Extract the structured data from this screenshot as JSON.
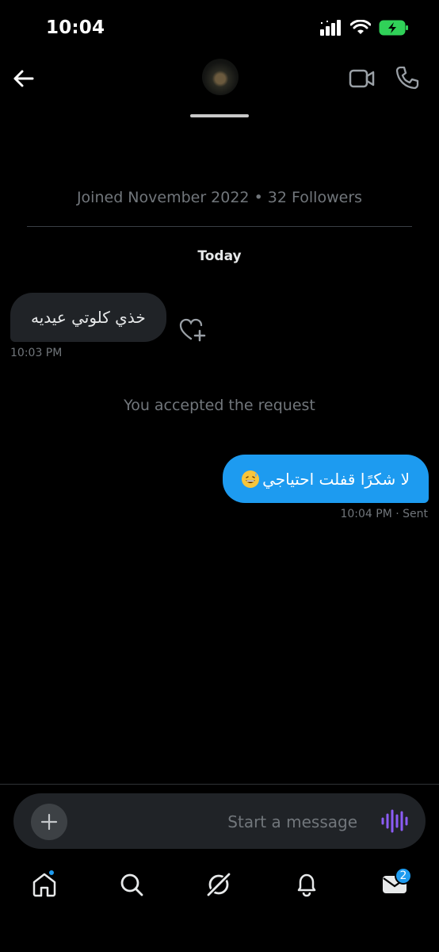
{
  "status_bar": {
    "time": "10:04"
  },
  "header": {
    "avatar_alt": "",
    "back_label": "",
    "video_label": "",
    "call_label": ""
  },
  "profile": {
    "joined_info": "Joined November 2022 • 32 Followers"
  },
  "conversation": {
    "date_label": "Today",
    "messages": [
      {
        "direction": "incoming",
        "text": "خذي كلوتي عيديه",
        "time": "10:03 PM"
      },
      {
        "direction": "outgoing",
        "text": "لا شكرًا قفلت احتياجي",
        "emoji": "grinning-sweat-emoji",
        "time": "10:04 PM",
        "status": "Sent"
      }
    ],
    "system_message": "You accepted the request",
    "outgoing_meta": "10:04 PM · Sent"
  },
  "composer": {
    "placeholder": "Start a message"
  },
  "nav": {
    "items": [
      {
        "name": "home",
        "icon": "home-icon"
      },
      {
        "name": "search",
        "icon": "search-icon"
      },
      {
        "name": "grok",
        "icon": "grok-icon"
      },
      {
        "name": "notifications",
        "icon": "bell-icon"
      },
      {
        "name": "messages",
        "icon": "mail-icon",
        "badge": "2"
      }
    ]
  },
  "colors": {
    "accent": "#1d9bf0",
    "background": "#000000",
    "incoming_bubble": "#202327",
    "muted_text": "#71767b"
  }
}
